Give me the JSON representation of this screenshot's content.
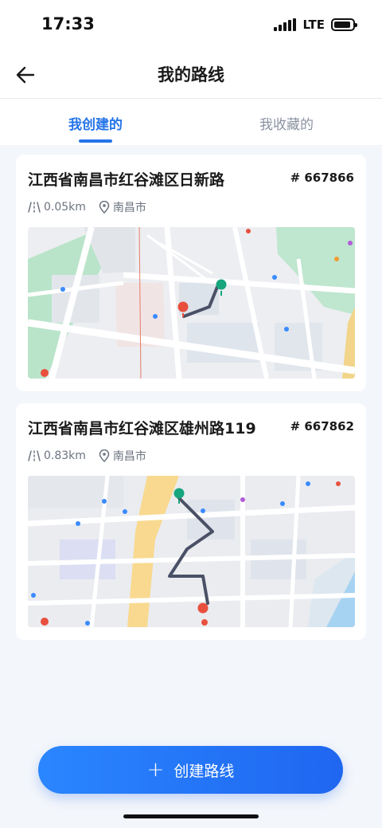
{
  "status": {
    "time": "17:33",
    "network": "LTE"
  },
  "nav": {
    "title": "我的路线"
  },
  "tabs": [
    {
      "label": "我创建的",
      "active": true
    },
    {
      "label": "我收藏的",
      "active": false
    }
  ],
  "routes": [
    {
      "title": "江西省南昌市红谷滩区日新路",
      "id": "# 667866",
      "distance": "0.05km",
      "city": "南昌市"
    },
    {
      "title": "江西省南昌市红谷滩区雄州路119",
      "id": "# 667862",
      "distance": "0.83km",
      "city": "南昌市"
    }
  ],
  "create_button": {
    "label": "创建路线"
  },
  "colors": {
    "accent": "#2474e8",
    "button": "#1f66f0",
    "route_line": "#4a5166",
    "start_marker": "#17a57d",
    "end_marker": "#e8503d"
  }
}
